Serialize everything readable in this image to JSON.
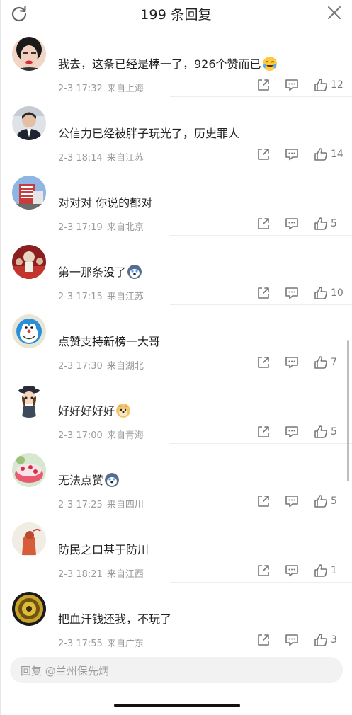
{
  "header": {
    "title": "199 条回复",
    "refresh_icon": "refresh-icon",
    "close_icon": "close-icon"
  },
  "comments": [
    {
      "avatar": "avatar-woman-portrait",
      "text": "我去，这条已经是棒一了，926个赞而已",
      "emoji": "laugh-cry-emoji",
      "time": "2-3 17:32",
      "location": "来自上海",
      "likes": "12"
    },
    {
      "avatar": "avatar-man-suit",
      "text": "公信力已经被胖子玩光了，历史罪人",
      "emoji": "",
      "time": "2-3 18:14",
      "location": "来自江苏",
      "likes": "14"
    },
    {
      "avatar": "avatar-building",
      "text": "对对对 你说的都对",
      "emoji": "",
      "time": "2-3 17:19",
      "location": "来自北京",
      "likes": "5"
    },
    {
      "avatar": "avatar-group-red",
      "text": "第一那条没了",
      "emoji": "husky-emoji",
      "time": "2-3 17:15",
      "location": "来自江苏",
      "likes": "10"
    },
    {
      "avatar": "avatar-robot-cat",
      "text": "点赞支持新榜一大哥",
      "emoji": "",
      "time": "2-3 17:30",
      "location": "来自湖北",
      "likes": "7"
    },
    {
      "avatar": "avatar-cartoon-girl",
      "text": "好好好好好",
      "emoji": "doge-emoji",
      "time": "2-3 17:00",
      "location": "来自青海",
      "likes": "5"
    },
    {
      "avatar": "avatar-cake",
      "text": "无法点赞",
      "emoji": "husky-emoji",
      "time": "2-3 17:25",
      "location": "来自四川",
      "likes": "5"
    },
    {
      "avatar": "avatar-red-figure",
      "text": "防民之口甚于防川",
      "emoji": "",
      "time": "2-3 18:21",
      "location": "来自江西",
      "likes": "1"
    },
    {
      "avatar": "avatar-gold-medallion",
      "text": "把血汗钱还我，不玩了",
      "emoji": "",
      "time": "2-3 17:55",
      "location": "来自广东",
      "likes": "3"
    }
  ],
  "action_icons": [
    "share-icon",
    "comment-icon",
    "thumbs-up-icon"
  ],
  "reply": {
    "placeholder": "回复 @兰州保先炳"
  },
  "colors": {
    "text_primary": "#222222",
    "text_secondary": "#9a9a9a",
    "background": "#ffffff",
    "input_bg": "#f2f2f2"
  }
}
